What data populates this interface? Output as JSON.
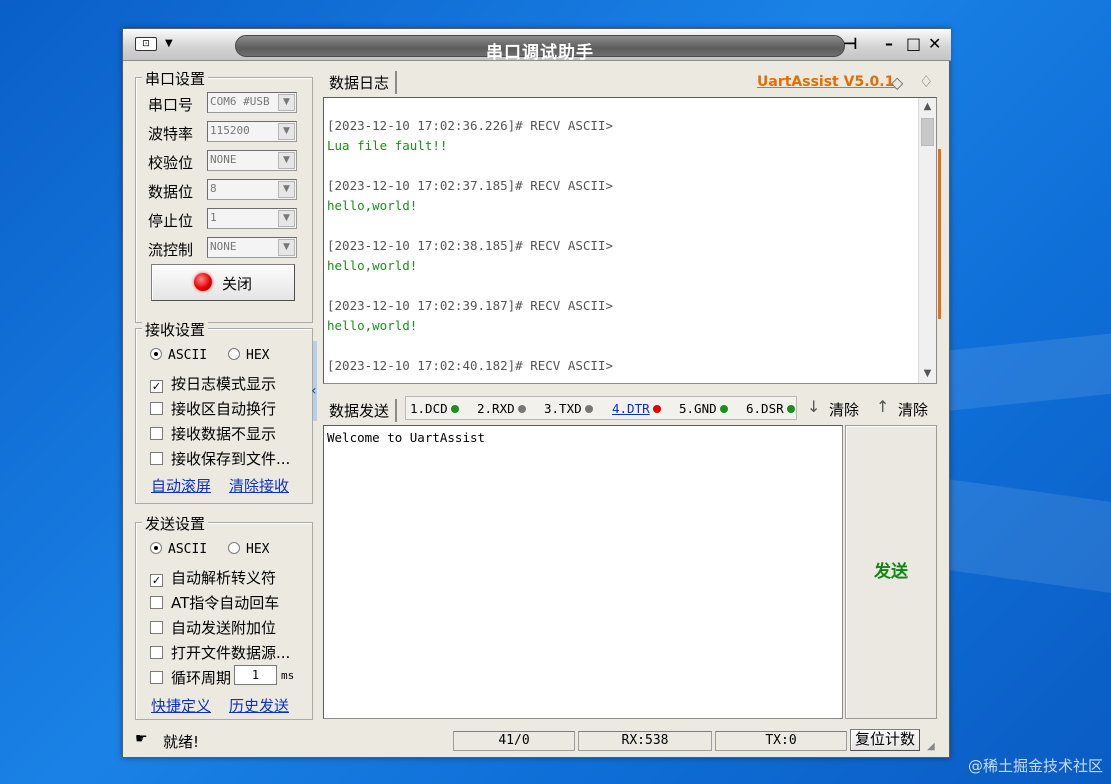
{
  "colors": {
    "accent_orange": "#e66e00",
    "green_text": "#1a8f1a",
    "link_blue": "#0a32c8",
    "led_red": "#e60000"
  },
  "window": {
    "title": "串口调试助手",
    "controls": {
      "pin": "⊣",
      "minimize": "–",
      "maximize": "□",
      "close": "✕"
    }
  },
  "serial": {
    "group_title": "串口设置",
    "fields": [
      {
        "label": "串口号",
        "value": "COM6 #USB"
      },
      {
        "label": "波特率",
        "value": "115200"
      },
      {
        "label": "校验位",
        "value": "NONE"
      },
      {
        "label": "数据位",
        "value": "8"
      },
      {
        "label": "停止位",
        "value": "1"
      },
      {
        "label": "流控制",
        "value": "NONE"
      }
    ],
    "open_button": "关闭"
  },
  "receive": {
    "group_title": "接收设置",
    "ascii": "ASCII",
    "hex": "HEX",
    "checks": [
      {
        "label": "按日志模式显示",
        "checked": true
      },
      {
        "label": "接收区自动换行",
        "checked": false
      },
      {
        "label": "接收数据不显示",
        "checked": false
      },
      {
        "label": "接收保存到文件...",
        "checked": false
      }
    ],
    "link_auto_scroll": "自动滚屏",
    "link_clear": "清除接收"
  },
  "send": {
    "group_title": "发送设置",
    "ascii": "ASCII",
    "hex": "HEX",
    "checks": [
      {
        "label": "自动解析转义符",
        "checked": true
      },
      {
        "label": "AT指令自动回车",
        "checked": false
      },
      {
        "label": "自动发送附加位",
        "checked": false
      },
      {
        "label": "打开文件数据源...",
        "checked": false
      }
    ],
    "cycle_label": "循环周期",
    "cycle_value": "1",
    "cycle_unit": "ms",
    "link_shortcut": "快捷定义",
    "link_history": "历史发送"
  },
  "log_panel": {
    "tab": "数据日志",
    "brand": "UartAssist V5.0.1",
    "entries": [
      {
        "header": "[2023-12-10 17:02:36.226]# RECV ASCII>",
        "message": "Lua file fault!!"
      },
      {
        "header": "[2023-12-10 17:02:37.185]# RECV ASCII>",
        "message": "hello,world!"
      },
      {
        "header": "[2023-12-10 17:02:38.185]# RECV ASCII>",
        "message": "hello,world!"
      },
      {
        "header": "[2023-12-10 17:02:39.187]# RECV ASCII>",
        "message": "hello,world!"
      },
      {
        "header": "[2023-12-10 17:02:40.182]# RECV ASCII>",
        "message": ""
      }
    ]
  },
  "send_panel": {
    "tab": "数据发送",
    "pins": [
      {
        "label": "1.DCD",
        "color": "#1a8f1a"
      },
      {
        "label": "2.RXD",
        "color": "#777777"
      },
      {
        "label": "3.TXD",
        "color": "#777777"
      },
      {
        "label": "4.DTR",
        "color": "#e60000"
      },
      {
        "label": "5.GND",
        "color": "#1a8f1a"
      },
      {
        "label": "6.DSR",
        "color": "#1a8f1a"
      }
    ],
    "clear1": "清除",
    "clear2": "清除",
    "content": "Welcome to UartAssist",
    "send_button": "发送"
  },
  "status": {
    "ready": "就绪!",
    "counts": "41/0",
    "rx": "RX:538",
    "tx": "TX:0",
    "reset": "复位计数"
  },
  "watermark": "@稀土掘金技术社区"
}
